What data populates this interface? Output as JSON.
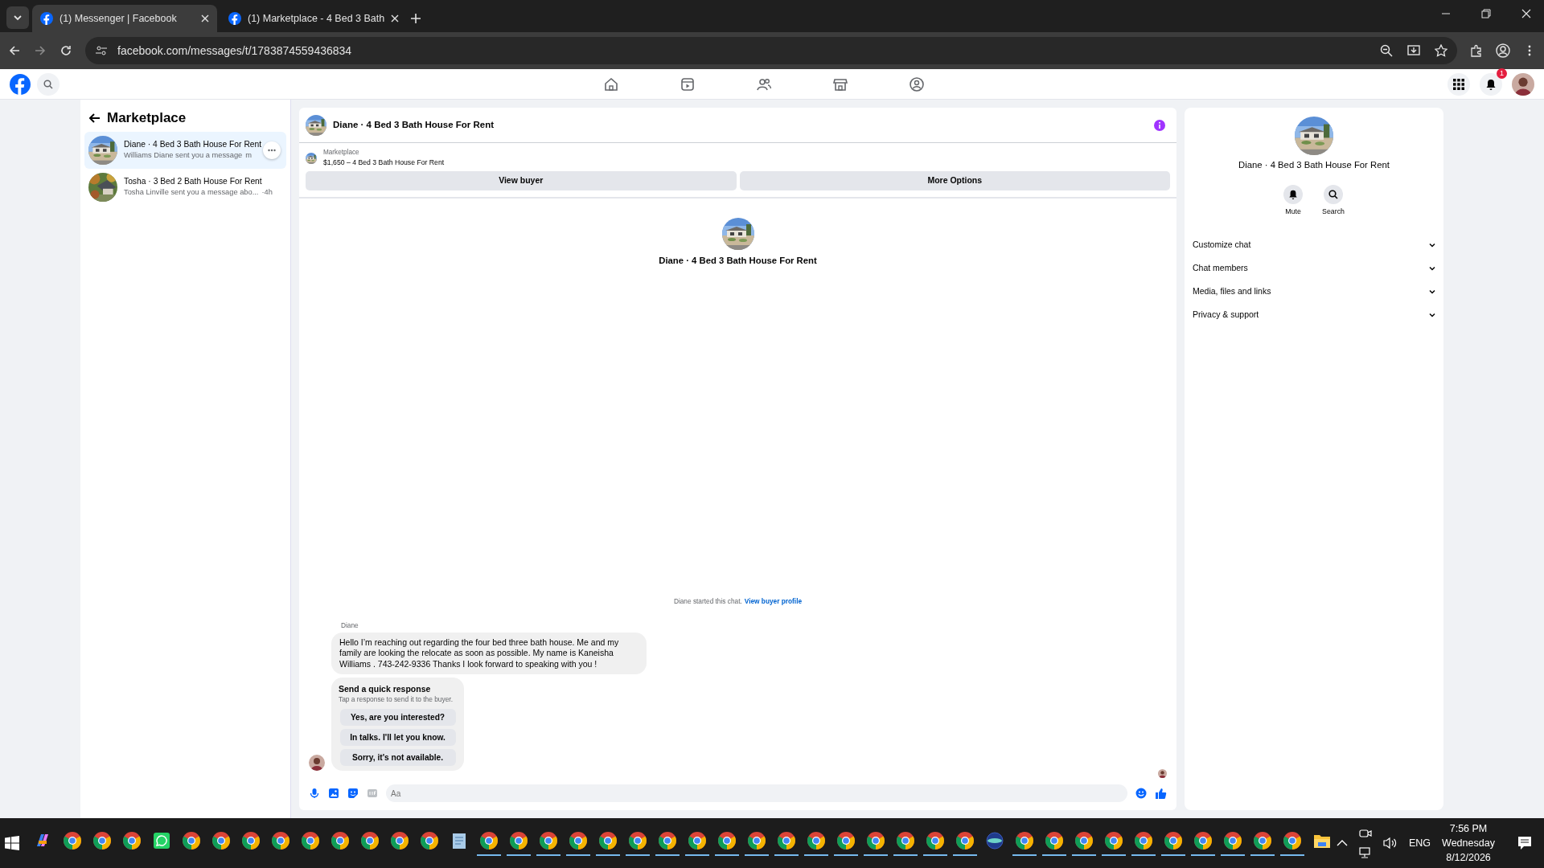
{
  "browser": {
    "tabs": [
      {
        "title": "(1) Messenger | Facebook",
        "selected": true
      },
      {
        "title": "(1) Marketplace - 4 Bed 3 Bath",
        "selected": false
      }
    ],
    "url": "facebook.com/messages/t/1783874559436834"
  },
  "fb_nav": {
    "items": [
      {
        "kind": "home"
      },
      {
        "kind": "video"
      },
      {
        "kind": "friends"
      },
      {
        "kind": "shop"
      },
      {
        "kind": "groups"
      }
    ],
    "notifications": "1"
  },
  "sidebar": {
    "title": "Marketplace",
    "threads": [
      {
        "title": "Diane · 4 Bed 3 Bath House For Rent",
        "preview": "Williams Diane sent you a message",
        "time": "m",
        "selected": true
      },
      {
        "title": "Tosha · 3 Bed 2 Bath House For Rent",
        "preview": "Tosha Linville sent you a message abo...",
        "time": "·4h",
        "selected": false
      }
    ]
  },
  "chat": {
    "title": "Diane · 4 Bed 3 Bath House For Rent",
    "listing": {
      "label": "Marketplace",
      "text": "$1,650 – 4 Bed 3 Bath House For Rent"
    },
    "buttons": [
      "View buyer",
      "More Options"
    ],
    "intro_name": "Diane · 4 Bed 3 Bath House For Rent",
    "system": {
      "text": "Diane started this chat.",
      "link": "View buyer profile"
    },
    "sender": "Diane",
    "message": "Hello I’m reaching out regarding the four bed three bath house. Me and my family are looking the relocate as soon as possible. My name is Kaneisha Williams  . 743-242-9336 Thanks I look forward to speaking with you !",
    "quick": {
      "title": "Send a quick response",
      "subtitle": "Tap a response to send it to the buyer.",
      "options": [
        "Yes, are you interested?",
        "In talks. I'll let you know.",
        "Sorry, it's not available."
      ]
    },
    "composer": {
      "placeholder": "Aa"
    }
  },
  "info": {
    "name": "Diane · 4 Bed 3 Bath House For Rent",
    "actions": [
      {
        "kind": "bell",
        "label": "Mute"
      },
      {
        "kind": "search",
        "label": "Search"
      }
    ],
    "sections": [
      {
        "label": "Customize chat",
        "expanded": false
      },
      {
        "label": "Chat members",
        "expanded": false
      },
      {
        "label": "Media, files and links",
        "expanded": false
      },
      {
        "label": "Privacy & support",
        "expanded": false
      }
    ]
  },
  "taskbar": {
    "apps": [
      {
        "kind": "copilot",
        "running": false
      },
      {
        "kind": "chrome",
        "running": false
      },
      {
        "kind": "chrome",
        "running": false
      },
      {
        "kind": "chrome",
        "running": false
      },
      {
        "kind": "whatsapp",
        "running": false
      },
      {
        "kind": "chrome",
        "running": false
      },
      {
        "kind": "chrome",
        "running": false
      },
      {
        "kind": "chrome",
        "running": false
      },
      {
        "kind": "chrome",
        "running": false
      },
      {
        "kind": "chrome",
        "running": false
      },
      {
        "kind": "chrome",
        "running": false
      },
      {
        "kind": "chrome",
        "running": false
      },
      {
        "kind": "chrome",
        "running": false
      },
      {
        "kind": "chrome",
        "running": false
      },
      {
        "kind": "notes",
        "running": false
      },
      {
        "kind": "chrome",
        "running": true
      },
      {
        "kind": "chrome",
        "running": true
      },
      {
        "kind": "chrome",
        "running": true
      },
      {
        "kind": "chrome",
        "running": true
      },
      {
        "kind": "chrome",
        "running": true
      },
      {
        "kind": "chrome",
        "running": true
      },
      {
        "kind": "chrome",
        "running": true
      },
      {
        "kind": "chrome",
        "running": true
      },
      {
        "kind": "chrome",
        "running": true
      },
      {
        "kind": "chrome",
        "running": true
      },
      {
        "kind": "chrome",
        "running": true
      },
      {
        "kind": "chrome",
        "running": true
      },
      {
        "kind": "chrome",
        "running": true
      },
      {
        "kind": "chrome",
        "running": true
      },
      {
        "kind": "chrome",
        "running": true
      },
      {
        "kind": "chrome",
        "running": true
      },
      {
        "kind": "chrome",
        "running": true
      },
      {
        "kind": "globe",
        "running": false
      },
      {
        "kind": "chrome",
        "running": true
      },
      {
        "kind": "chrome",
        "running": true
      },
      {
        "kind": "chrome",
        "running": true
      },
      {
        "kind": "chrome",
        "running": true
      },
      {
        "kind": "chrome",
        "running": true
      },
      {
        "kind": "chrome",
        "running": true
      },
      {
        "kind": "chrome",
        "running": true
      },
      {
        "kind": "chrome",
        "running": true
      },
      {
        "kind": "chrome",
        "running": true
      },
      {
        "kind": "chrome",
        "running": true
      },
      {
        "kind": "folder",
        "running": false
      }
    ],
    "lang": "ENG",
    "time": "7:56 PM",
    "day": "Wednesday",
    "date": "8/12/2026"
  }
}
